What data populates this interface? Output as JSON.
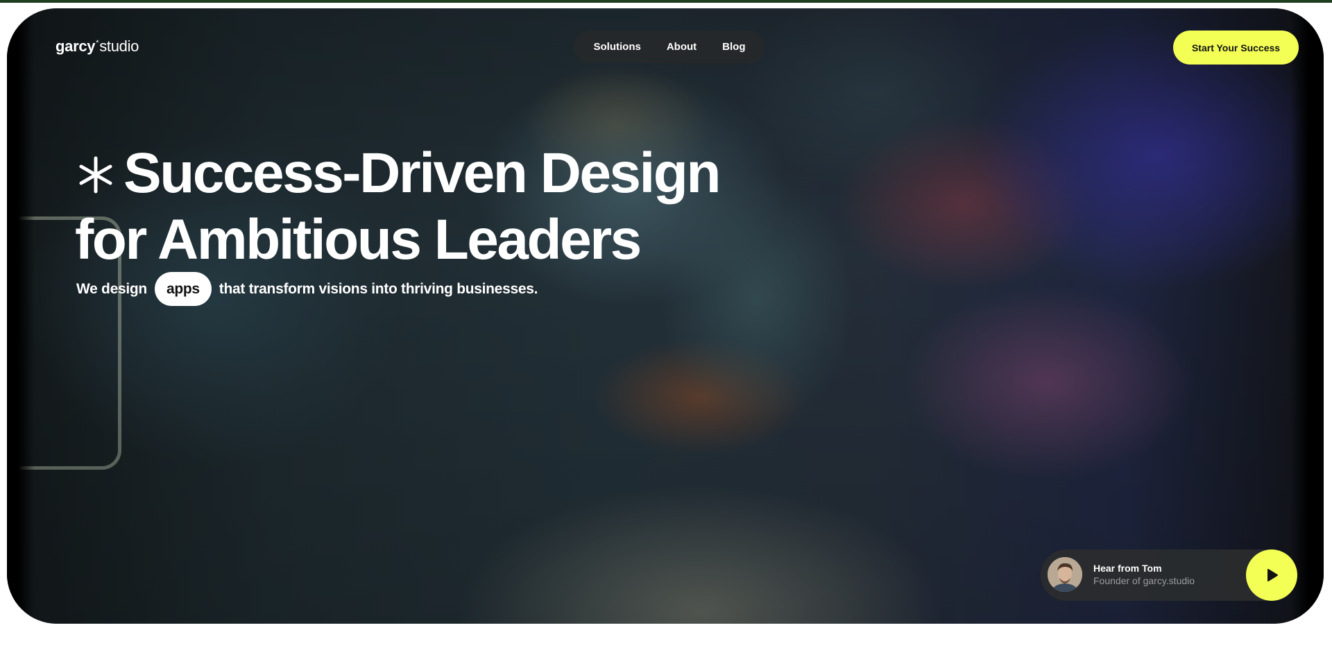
{
  "brand": {
    "name_bold": "garcy",
    "name_mark": "*",
    "name_light": "studio"
  },
  "nav": {
    "items": [
      {
        "label": "Solutions"
      },
      {
        "label": "About"
      },
      {
        "label": "Blog"
      }
    ]
  },
  "cta": {
    "label": "Start Your Success"
  },
  "hero": {
    "headline_line1": "Success-Driven Design",
    "headline_line2": "for Ambitious Leaders",
    "sub_prefix": "We design",
    "sub_pill": "apps",
    "sub_suffix": "that transform visions into thriving businesses."
  },
  "testimonial": {
    "title": "Hear from Tom",
    "subtitle": "Founder of garcy.studio",
    "play_icon": "play-icon"
  },
  "colors": {
    "accent": "#f4ff55",
    "text": "#ffffff",
    "card_bg": "#2a2c2e"
  }
}
